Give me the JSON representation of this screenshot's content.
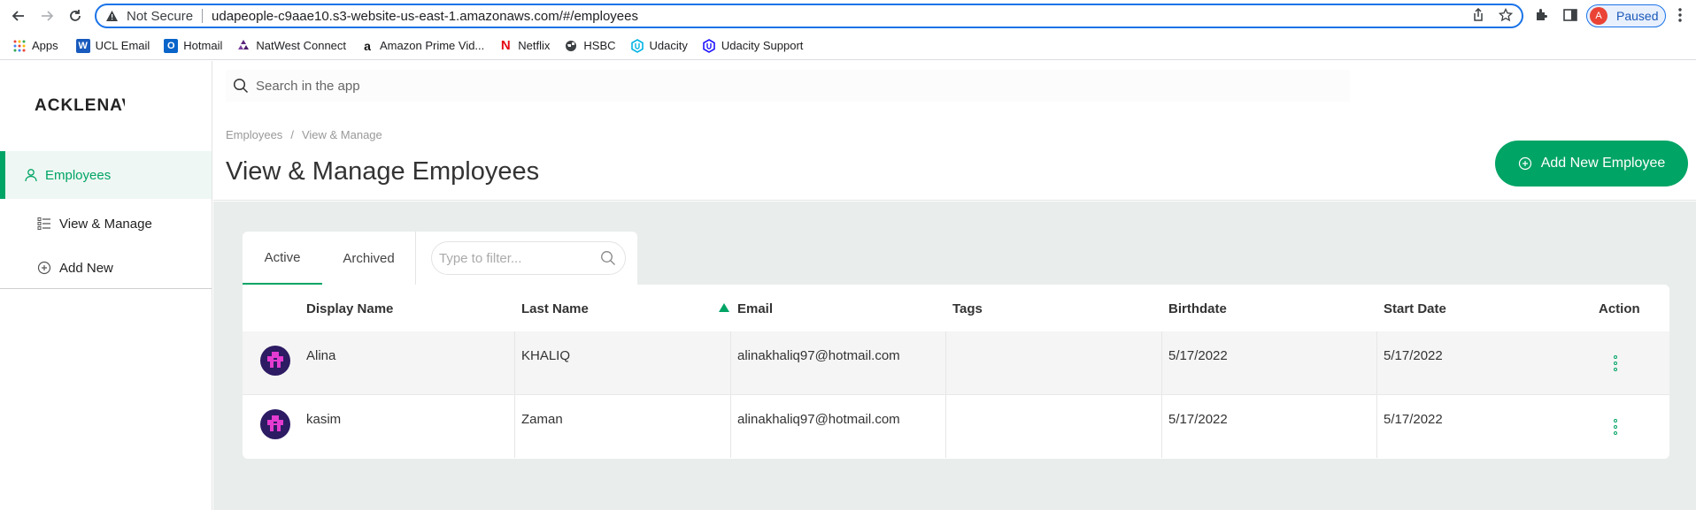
{
  "browser": {
    "security_label": "Not Secure",
    "url": "udapeople-c9aae10.s3-website-us-east-1.amazonaws.com/#/employees",
    "profile_initial": "A",
    "profile_status": "Paused",
    "bookmarks": [
      "Apps",
      "UCL Email",
      "Hotmail",
      "NatWest Connect",
      "Amazon Prime Vid...",
      "Netflix",
      "HSBC",
      "Udacity",
      "Udacity Support"
    ]
  },
  "app": {
    "logo": "ACKLENAVE",
    "search_placeholder": "Search in the app",
    "sidebar": {
      "section": "Employees",
      "items": [
        "View & Manage",
        "Add New"
      ]
    },
    "breadcrumb": [
      "Employees",
      "View & Manage"
    ],
    "page_title": "View & Manage Employees",
    "add_button": "Add New Employee",
    "tabs": [
      "Active",
      "Archived"
    ],
    "filter_placeholder": "Type to filter...",
    "columns": [
      "Display Name",
      "Last Name",
      "Email",
      "Tags",
      "Birthdate",
      "Start Date",
      "Action"
    ],
    "rows": [
      {
        "display_name": "Alina",
        "last_name": "KHALIQ",
        "email": "alinakhaliq97@hotmail.com",
        "tags": "",
        "birthdate": "5/17/2022",
        "start_date": "5/17/2022"
      },
      {
        "display_name": "kasim",
        "last_name": "Zaman",
        "email": "alinakhaliq97@hotmail.com",
        "tags": "",
        "birthdate": "5/17/2022",
        "start_date": "5/17/2022"
      }
    ]
  },
  "colors": {
    "accent": "#00a465",
    "content_bg": "#e9eeec",
    "chrome_focus": "#1a73e8"
  }
}
